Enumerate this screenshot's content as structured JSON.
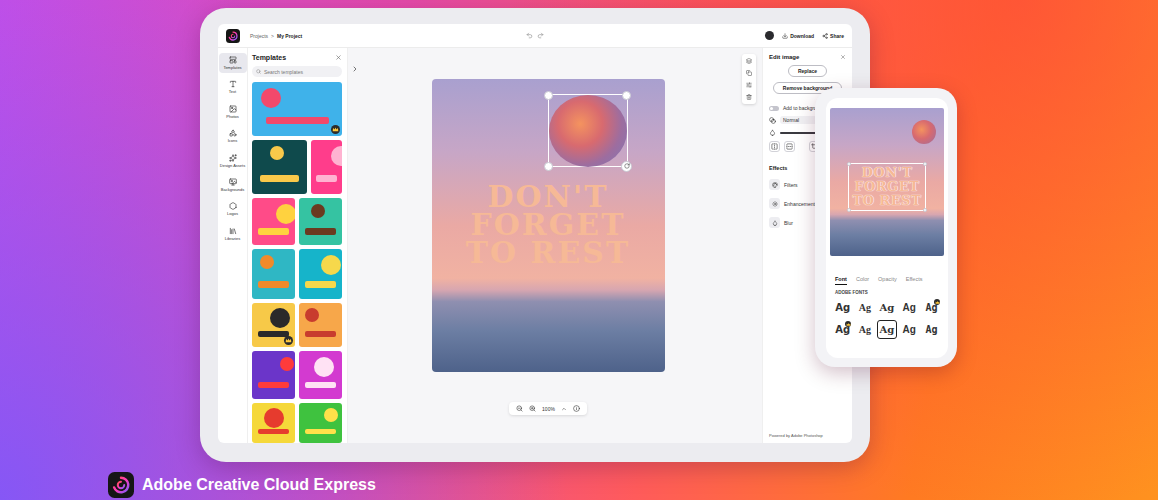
{
  "brand": {
    "name": "Adobe Creative Cloud Express"
  },
  "topbar": {
    "breadcrumb": [
      "Projects",
      "My Project"
    ],
    "separator": ">",
    "actions": [
      "Download",
      "Share"
    ]
  },
  "rail": [
    {
      "label": "Templates",
      "selected": true
    },
    {
      "label": "Text",
      "selected": false
    },
    {
      "label": "Photos",
      "selected": false
    },
    {
      "label": "Icons",
      "selected": false
    },
    {
      "label": "Design Assets",
      "selected": false
    },
    {
      "label": "Backgrounds",
      "selected": false
    },
    {
      "label": "Logos",
      "selected": false
    },
    {
      "label": "Libraries",
      "selected": false
    }
  ],
  "templates_panel": {
    "title": "Templates",
    "search_placeholder": "Search templates",
    "rows": [
      [
        {
          "color": "#3fb2ea",
          "accent": "#f2496b",
          "premium": true
        }
      ],
      [
        {
          "color": "#0f4a4c",
          "accent": "#f9c94a",
          "premium": false
        },
        {
          "color": "#ff3d8b",
          "accent": "#ffb3d1",
          "premium": false
        }
      ],
      [
        {
          "color": "#ff4b88",
          "accent": "#ffd23f",
          "premium": false
        },
        {
          "color": "#35c3a2",
          "accent": "#6b3a1f",
          "premium": false
        }
      ],
      [
        {
          "color": "#2fb7c4",
          "accent": "#f08a2a",
          "premium": false
        },
        {
          "color": "#16b4ca",
          "accent": "#f6d84b",
          "premium": false
        }
      ],
      [
        {
          "color": "#f7c948",
          "accent": "#2a2a2a",
          "premium": true
        },
        {
          "color": "#f7a74a",
          "accent": "#c83c2e",
          "premium": false
        }
      ],
      [
        {
          "color": "#6b35c9",
          "accent": "#ff3b3b",
          "premium": false
        },
        {
          "color": "#d33ad0",
          "accent": "#ffe2f4",
          "premium": false
        }
      ],
      [
        {
          "color": "#f5d83a",
          "accent": "#e63b2e",
          "premium": false
        },
        {
          "color": "#3fc23f",
          "accent": "#ffe14a",
          "premium": false
        }
      ]
    ]
  },
  "canvas": {
    "headline": [
      "DON'T",
      "FORGET",
      "TO REST"
    ],
    "sticker_selected": true
  },
  "zoom": {
    "value": "100%"
  },
  "edit_panel": {
    "title": "Edit image",
    "buttons": [
      "Replace",
      "Remove background"
    ],
    "add_to_background": {
      "label": "Add to background",
      "on": false
    },
    "blend_mode": "Normal",
    "opacity": {
      "level": 0.85
    },
    "effects_title": "Effects",
    "effects": [
      "Filters",
      "Enhancements",
      "Blur"
    ],
    "footer": "Powered by Adobe Photoshop"
  },
  "phone": {
    "text_selected": true,
    "tabs": [
      {
        "label": "Font",
        "selected": true
      },
      {
        "label": "Color",
        "selected": false
      },
      {
        "label": "Opacity",
        "selected": false
      },
      {
        "label": "Effects",
        "selected": false
      }
    ],
    "section": "ADOBE FONTS",
    "fonts": [
      {
        "sample": "Ag",
        "selected": false,
        "premium": false
      },
      {
        "sample": "Ag",
        "selected": false,
        "premium": false
      },
      {
        "sample": "Ag",
        "selected": false,
        "premium": false
      },
      {
        "sample": "Ag",
        "selected": false,
        "premium": false
      },
      {
        "sample": "Ag",
        "selected": false,
        "premium": true
      },
      {
        "sample": "Ag",
        "selected": false,
        "premium": true
      },
      {
        "sample": "Ag",
        "selected": false,
        "premium": false
      },
      {
        "sample": "Ag",
        "selected": true,
        "premium": false
      },
      {
        "sample": "Ag",
        "selected": false,
        "premium": false
      },
      {
        "sample": "Ag",
        "selected": false,
        "premium": false
      }
    ]
  }
}
